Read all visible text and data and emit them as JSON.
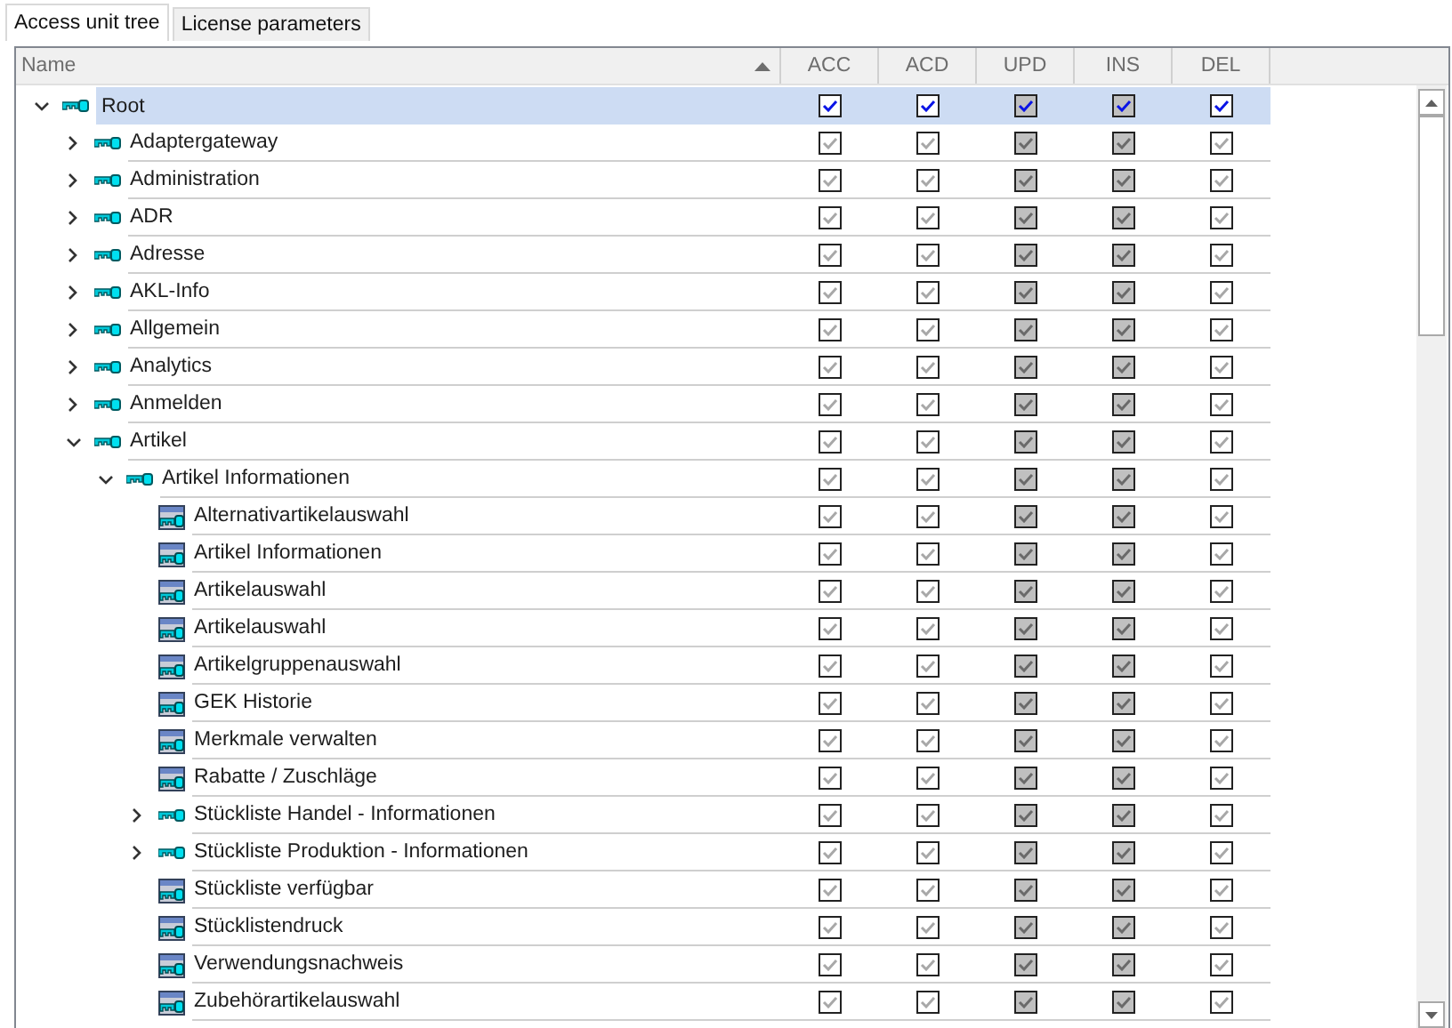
{
  "tabs": [
    {
      "label": "Access unit tree",
      "selected": true
    },
    {
      "label": "License parameters",
      "selected": false
    }
  ],
  "table": {
    "columns": [
      {
        "label": "Name",
        "kind": "name",
        "sorted": true
      },
      {
        "label": "ACC",
        "kind": "open"
      },
      {
        "label": "ACD",
        "kind": "open"
      },
      {
        "label": "UPD",
        "kind": "fixed"
      },
      {
        "label": "INS",
        "kind": "fixed"
      },
      {
        "label": "DEL",
        "kind": "open"
      }
    ],
    "rows": [
      {
        "label": "Root",
        "kind": "group",
        "expanded": true,
        "selected": true,
        "disabled": false,
        "cells": [
          {
            "checked": true
          },
          {
            "checked": true
          },
          {
            "checked": true
          },
          {
            "checked": true
          },
          {
            "checked": true
          }
        ],
        "children": [
          {
            "label": "Adaptergateway",
            "kind": "group",
            "expanded": false,
            "selected": false,
            "disabled": true,
            "cells": [
              {
                "checked": true
              },
              {
                "checked": true
              },
              {
                "checked": true
              },
              {
                "checked": true
              },
              {
                "checked": true
              }
            ]
          },
          {
            "label": "Administration",
            "kind": "group",
            "expanded": false,
            "selected": false,
            "disabled": true,
            "cells": [
              {
                "checked": true
              },
              {
                "checked": true
              },
              {
                "checked": true
              },
              {
                "checked": true
              },
              {
                "checked": true
              }
            ]
          },
          {
            "label": "ADR",
            "kind": "group",
            "expanded": false,
            "selected": false,
            "disabled": true,
            "cells": [
              {
                "checked": true
              },
              {
                "checked": true
              },
              {
                "checked": true
              },
              {
                "checked": true
              },
              {
                "checked": true
              }
            ]
          },
          {
            "label": "Adresse",
            "kind": "group",
            "expanded": false,
            "selected": false,
            "disabled": true,
            "cells": [
              {
                "checked": true
              },
              {
                "checked": true
              },
              {
                "checked": true
              },
              {
                "checked": true
              },
              {
                "checked": true
              }
            ]
          },
          {
            "label": "AKL-Info",
            "kind": "group",
            "expanded": false,
            "selected": false,
            "disabled": true,
            "cells": [
              {
                "checked": true
              },
              {
                "checked": true
              },
              {
                "checked": true
              },
              {
                "checked": true
              },
              {
                "checked": true
              }
            ]
          },
          {
            "label": "Allgemein",
            "kind": "group",
            "expanded": false,
            "selected": false,
            "disabled": true,
            "cells": [
              {
                "checked": true
              },
              {
                "checked": true
              },
              {
                "checked": true
              },
              {
                "checked": true
              },
              {
                "checked": true
              }
            ]
          },
          {
            "label": "Analytics",
            "kind": "group",
            "expanded": false,
            "selected": false,
            "disabled": true,
            "cells": [
              {
                "checked": true
              },
              {
                "checked": true
              },
              {
                "checked": true
              },
              {
                "checked": true
              },
              {
                "checked": true
              }
            ]
          },
          {
            "label": "Anmelden",
            "kind": "group",
            "expanded": false,
            "selected": false,
            "disabled": true,
            "cells": [
              {
                "checked": true
              },
              {
                "checked": true
              },
              {
                "checked": true
              },
              {
                "checked": true
              },
              {
                "checked": true
              }
            ]
          },
          {
            "label": "Artikel",
            "kind": "group",
            "expanded": true,
            "selected": false,
            "disabled": true,
            "cells": [
              {
                "checked": true
              },
              {
                "checked": true
              },
              {
                "checked": true
              },
              {
                "checked": true
              },
              {
                "checked": true
              }
            ],
            "children": [
              {
                "label": "Artikel Informationen",
                "kind": "group",
                "expanded": true,
                "selected": false,
                "disabled": true,
                "cells": [
                  {
                    "checked": true
                  },
                  {
                    "checked": true
                  },
                  {
                    "checked": true
                  },
                  {
                    "checked": true
                  },
                  {
                    "checked": true
                  }
                ],
                "children": [
                  {
                    "label": "Alternativartikelauswahl",
                    "kind": "unit",
                    "selected": false,
                    "disabled": true,
                    "cells": [
                      {
                        "checked": true
                      },
                      {
                        "checked": true
                      },
                      {
                        "checked": true
                      },
                      {
                        "checked": true
                      },
                      {
                        "checked": true
                      }
                    ]
                  },
                  {
                    "label": "Artikel Informationen",
                    "kind": "unit",
                    "selected": false,
                    "disabled": true,
                    "cells": [
                      {
                        "checked": true
                      },
                      {
                        "checked": true
                      },
                      {
                        "checked": true
                      },
                      {
                        "checked": true
                      },
                      {
                        "checked": true
                      }
                    ]
                  },
                  {
                    "label": "Artikelauswahl",
                    "kind": "unit",
                    "selected": false,
                    "disabled": true,
                    "cells": [
                      {
                        "checked": true
                      },
                      {
                        "checked": true
                      },
                      {
                        "checked": true
                      },
                      {
                        "checked": true
                      },
                      {
                        "checked": true
                      }
                    ]
                  },
                  {
                    "label": "Artikelauswahl",
                    "kind": "unit",
                    "selected": false,
                    "disabled": true,
                    "cells": [
                      {
                        "checked": true
                      },
                      {
                        "checked": true
                      },
                      {
                        "checked": true
                      },
                      {
                        "checked": true
                      },
                      {
                        "checked": true
                      }
                    ]
                  },
                  {
                    "label": "Artikelgruppenauswahl",
                    "kind": "unit",
                    "selected": false,
                    "disabled": true,
                    "cells": [
                      {
                        "checked": true
                      },
                      {
                        "checked": true
                      },
                      {
                        "checked": true
                      },
                      {
                        "checked": true
                      },
                      {
                        "checked": true
                      }
                    ]
                  },
                  {
                    "label": "GEK Historie",
                    "kind": "unit",
                    "selected": false,
                    "disabled": true,
                    "cells": [
                      {
                        "checked": true
                      },
                      {
                        "checked": true
                      },
                      {
                        "checked": true
                      },
                      {
                        "checked": true
                      },
                      {
                        "checked": true
                      }
                    ]
                  },
                  {
                    "label": "Merkmale verwalten",
                    "kind": "unit",
                    "selected": false,
                    "disabled": true,
                    "cells": [
                      {
                        "checked": true
                      },
                      {
                        "checked": true
                      },
                      {
                        "checked": true
                      },
                      {
                        "checked": true
                      },
                      {
                        "checked": true
                      }
                    ]
                  },
                  {
                    "label": "Rabatte / Zuschläge",
                    "kind": "unit",
                    "selected": false,
                    "disabled": true,
                    "cells": [
                      {
                        "checked": true
                      },
                      {
                        "checked": true
                      },
                      {
                        "checked": true
                      },
                      {
                        "checked": true
                      },
                      {
                        "checked": true
                      }
                    ]
                  },
                  {
                    "label": "Stückliste Handel - Informationen",
                    "kind": "group",
                    "expanded": false,
                    "selected": false,
                    "disabled": true,
                    "cells": [
                      {
                        "checked": true
                      },
                      {
                        "checked": true
                      },
                      {
                        "checked": true
                      },
                      {
                        "checked": true
                      },
                      {
                        "checked": true
                      }
                    ]
                  },
                  {
                    "label": "Stückliste Produktion - Informationen",
                    "kind": "group",
                    "expanded": false,
                    "selected": false,
                    "disabled": true,
                    "cells": [
                      {
                        "checked": true
                      },
                      {
                        "checked": true
                      },
                      {
                        "checked": true
                      },
                      {
                        "checked": true
                      },
                      {
                        "checked": true
                      }
                    ]
                  },
                  {
                    "label": "Stückliste verfügbar",
                    "kind": "unit",
                    "selected": false,
                    "disabled": true,
                    "cells": [
                      {
                        "checked": true
                      },
                      {
                        "checked": true
                      },
                      {
                        "checked": true
                      },
                      {
                        "checked": true
                      },
                      {
                        "checked": true
                      }
                    ]
                  },
                  {
                    "label": "Stücklistendruck",
                    "kind": "unit",
                    "selected": false,
                    "disabled": true,
                    "cells": [
                      {
                        "checked": true
                      },
                      {
                        "checked": true
                      },
                      {
                        "checked": true
                      },
                      {
                        "checked": true
                      },
                      {
                        "checked": true
                      }
                    ]
                  },
                  {
                    "label": "Verwendungsnachweis",
                    "kind": "unit",
                    "selected": false,
                    "disabled": true,
                    "cells": [
                      {
                        "checked": true
                      },
                      {
                        "checked": true
                      },
                      {
                        "checked": true
                      },
                      {
                        "checked": true
                      },
                      {
                        "checked": true
                      }
                    ]
                  },
                  {
                    "label": "Zubehörartikelauswahl",
                    "kind": "unit",
                    "selected": false,
                    "disabled": true,
                    "cells": [
                      {
                        "checked": true
                      },
                      {
                        "checked": true
                      },
                      {
                        "checked": true
                      },
                      {
                        "checked": true
                      },
                      {
                        "checked": true
                      }
                    ]
                  }
                ]
              }
            ]
          }
        ]
      }
    ]
  }
}
